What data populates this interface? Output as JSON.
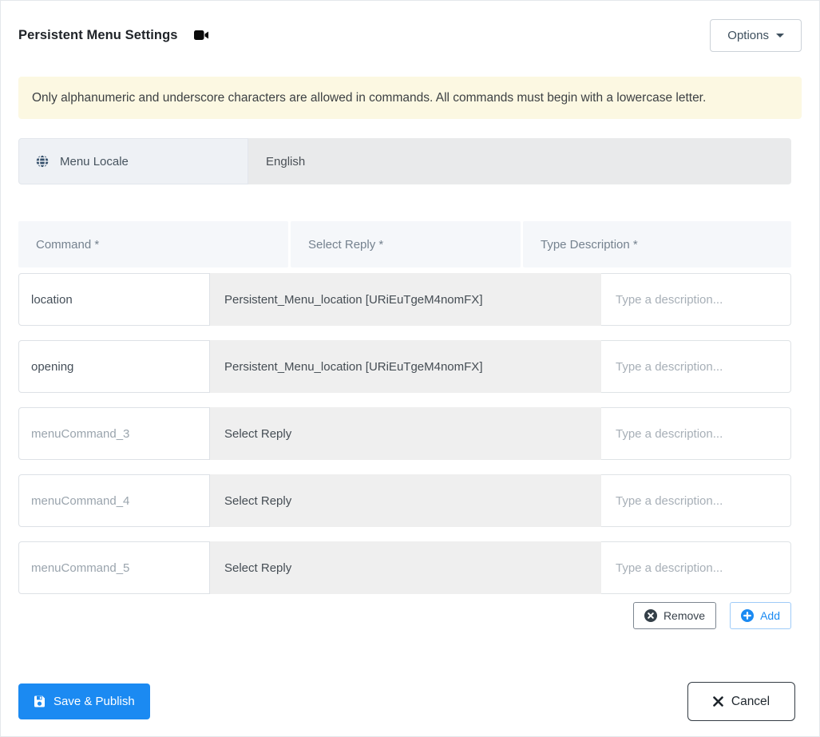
{
  "header": {
    "title": "Persistent Menu Settings",
    "options_label": "Options"
  },
  "alert": {
    "text": "Only alphanumeric and underscore characters are allowed in commands. All commands must begin with a lowercase letter."
  },
  "locale": {
    "label": "Menu Locale",
    "value": "English"
  },
  "table": {
    "headers": [
      "Command *",
      "Select Reply *",
      "Type Description *"
    ],
    "description_placeholder": "Type a description...",
    "rows": [
      {
        "command_value": "location",
        "reply": "Persistent_Menu_location [URiEuTgeM4nomFX]"
      },
      {
        "command_value": "opening",
        "reply": "Persistent_Menu_location [URiEuTgeM4nomFX]"
      },
      {
        "command_placeholder": "menuCommand_3",
        "reply": "Select Reply"
      },
      {
        "command_placeholder": "menuCommand_4",
        "reply": "Select Reply"
      },
      {
        "command_placeholder": "menuCommand_5",
        "reply": "Select Reply"
      }
    ]
  },
  "actions": {
    "remove_label": "Remove",
    "add_label": "Add"
  },
  "footer": {
    "save_label": "Save & Publish",
    "cancel_label": "Cancel"
  },
  "icons": {
    "title_icon": "video-camera-icon",
    "locale_icon": "globe-icon",
    "options_icon": "caret-down-icon",
    "remove_icon": "circle-x-icon",
    "add_icon": "circle-plus-icon",
    "save_icon": "floppy-icon",
    "cancel_icon": "x-icon"
  },
  "colors": {
    "primary_blue": "#1b8af2",
    "alert_bg": "#fcf8e2",
    "header_cell_bg": "#f5f7fa",
    "select_bg": "#efefef",
    "locale_addon_bg": "#eef1f5",
    "locale_value_bg": "#e9eaeb",
    "dark_text": "#1f2328",
    "muted_text": "#75828f",
    "placeholder_text": "#a7afb7"
  }
}
